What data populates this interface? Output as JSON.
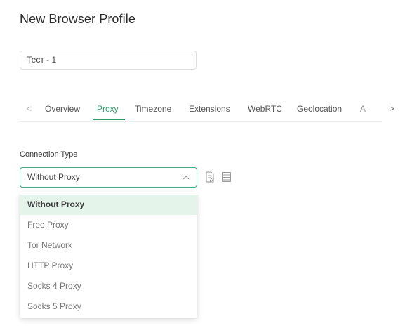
{
  "page": {
    "title": "New Browser Profile"
  },
  "profile": {
    "name_value": "Тест - 1"
  },
  "tabs": {
    "prev_arrow": "<",
    "next_arrow": ">",
    "items": [
      {
        "label": "Overview"
      },
      {
        "label": "Proxy",
        "active": true
      },
      {
        "label": "Timezone"
      },
      {
        "label": "Extensions"
      },
      {
        "label": "WebRTC"
      },
      {
        "label": "Geolocation"
      },
      {
        "label": "A"
      }
    ]
  },
  "connection": {
    "label": "Connection Type",
    "selected_value": "Without Proxy",
    "options": [
      {
        "label": "Without Proxy",
        "selected": true
      },
      {
        "label": "Free Proxy"
      },
      {
        "label": "Tor Network"
      },
      {
        "label": "HTTP Proxy"
      },
      {
        "label": "Socks 4 Proxy"
      },
      {
        "label": "Socks 5 Proxy"
      }
    ]
  },
  "icons": {
    "dropdown_caret": "chevron-up-icon",
    "edit": "edit-document-icon",
    "list": "list-icon"
  },
  "colors": {
    "accent": "#2f9a68",
    "selected_bg": "#e4f4ea",
    "select_border": "#3fae7e"
  }
}
